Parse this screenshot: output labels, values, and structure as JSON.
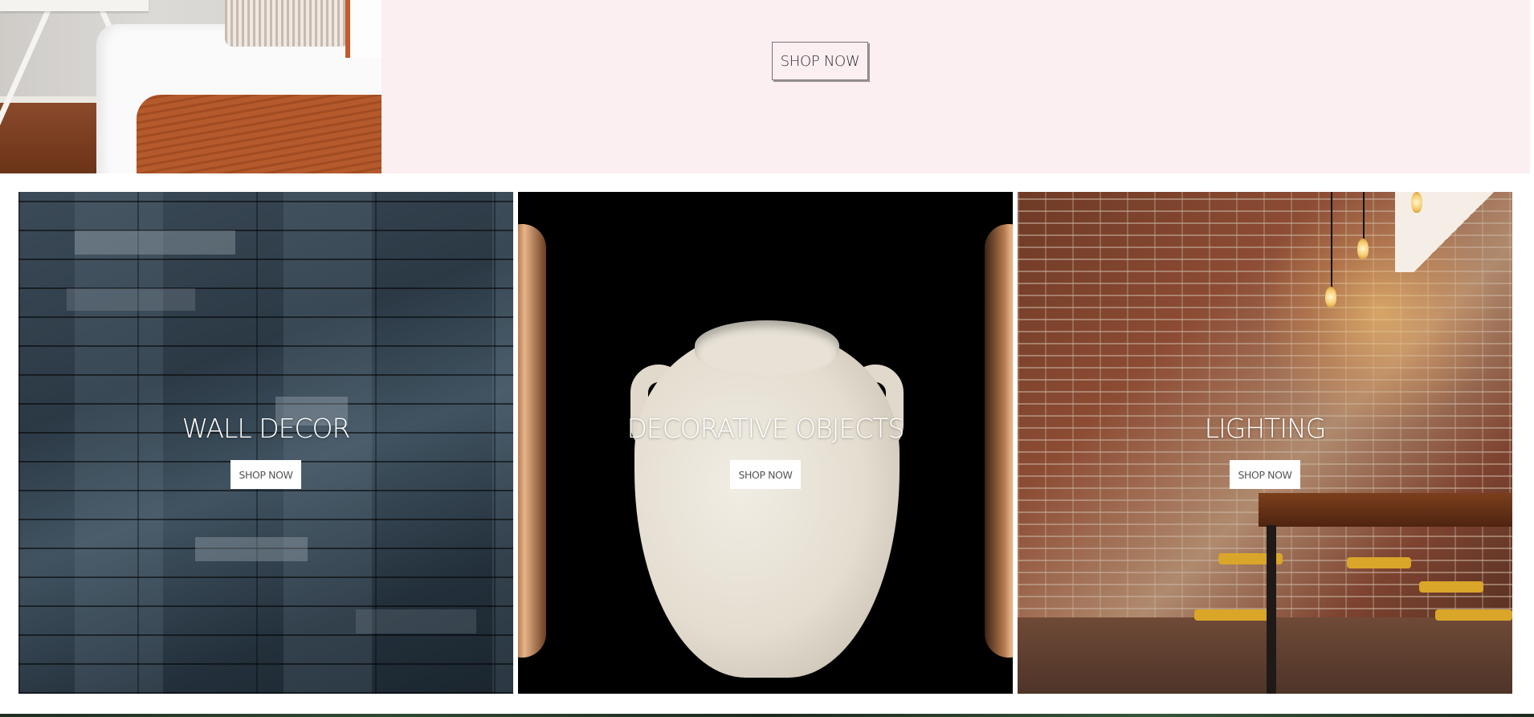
{
  "hero": {
    "button_label": "SHOP NOW"
  },
  "categories": [
    {
      "title": "WALL DECOR",
      "button_label": "SHOP NOW"
    },
    {
      "title": "DECORATIVE OBJECTS",
      "button_label": "SHOP NOW"
    },
    {
      "title": "LIGHTING",
      "button_label": "SHOP NOW"
    }
  ],
  "colors": {
    "hero_background": "#fbeff2",
    "page_background": "#ffffff",
    "tile_button_background": "#ffffff",
    "tile_title_color": "#ffffff"
  }
}
